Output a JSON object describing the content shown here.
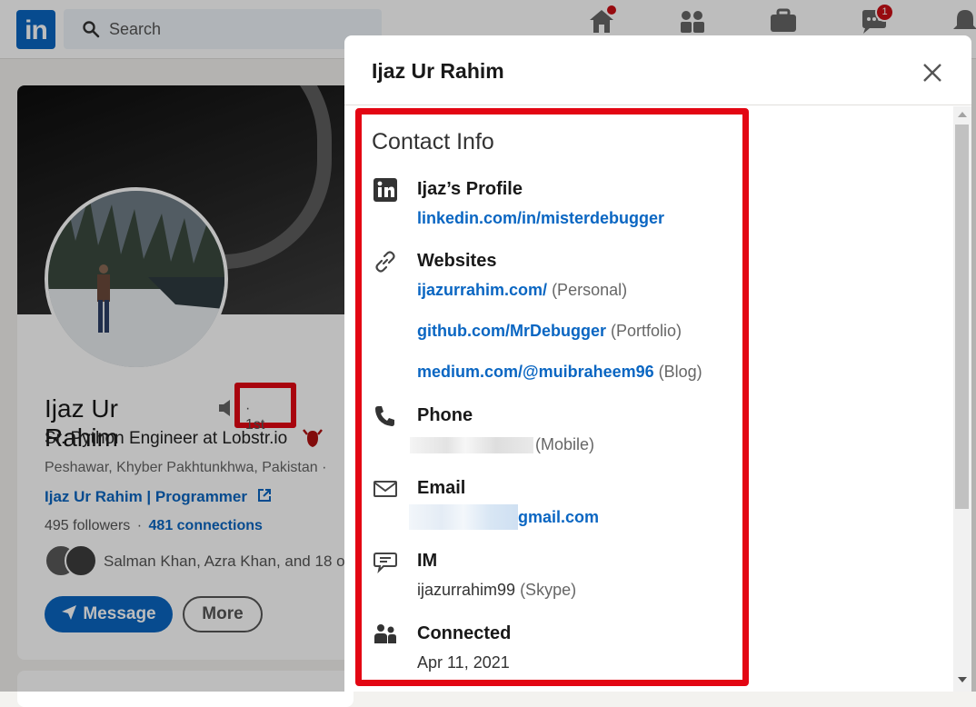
{
  "header": {
    "logo_text": "in",
    "search_placeholder": "Search",
    "nav_icons": [
      {
        "icon": "home-icon",
        "badge": ""
      },
      {
        "icon": "my-network-icon",
        "badge": ""
      },
      {
        "icon": "jobs-icon",
        "badge": ""
      },
      {
        "icon": "messaging-icon",
        "badge": "1"
      },
      {
        "icon": "notifications-icon",
        "badge": ""
      }
    ]
  },
  "profile": {
    "name": "Ijaz Ur Rahim",
    "degree": "· 1st",
    "headline": "Sr. Python Engineer at Lobstr.io",
    "location": "Peshawar, Khyber Pakhtunkhwa, Pakistan ·",
    "website_link": "Ijaz Ur Rahim | Programmer",
    "followers": "495 followers",
    "connections": "481 connections",
    "mutual": "Salman Khan, Azra Khan, and 18 o",
    "message_button": "Message",
    "more_button": "More"
  },
  "modal": {
    "title": "Ijaz Ur Rahim",
    "contact_title": "Contact Info",
    "profile": {
      "label": "Ijaz’s Profile",
      "url": "linkedin.com/in/misterdebugger"
    },
    "websites": {
      "label": "Websites",
      "items": [
        {
          "url": "ijazurrahim.com/",
          "type": "(Personal)"
        },
        {
          "url": "github.com/MrDebugger",
          "type": "(Portfolio)"
        },
        {
          "url": "medium.com/@muibraheem96",
          "type": "(Blog)"
        }
      ]
    },
    "phone": {
      "label": "Phone",
      "type": "(Mobile)"
    },
    "email": {
      "label": "Email",
      "domain": "gmail.com"
    },
    "im": {
      "label": "IM",
      "handle": "ijazurrahim99",
      "service": "(Skype)"
    },
    "connected": {
      "label": "Connected",
      "date": "Apr 11, 2021"
    }
  },
  "colors": {
    "linkedin_blue": "#0a66c2",
    "highlight_red": "#e30613",
    "notification_red": "#cc1016"
  }
}
